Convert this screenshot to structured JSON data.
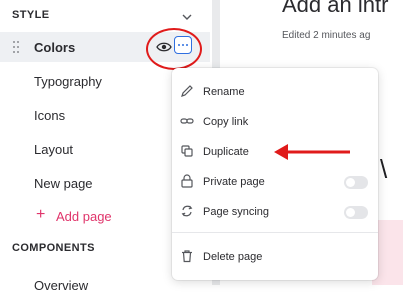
{
  "sidebar": {
    "style_header": "STYLE",
    "items": [
      {
        "label": "Colors"
      },
      {
        "label": "Typography"
      },
      {
        "label": "Icons"
      },
      {
        "label": "Layout"
      },
      {
        "label": "New page"
      }
    ],
    "add_page_label": "Add page",
    "add_page_plus": "+",
    "components_header": "COMPONENTS",
    "overview_label": "Overview"
  },
  "main": {
    "title": "Add an intr",
    "subtitle": "Edited 2 minutes ag",
    "ghost_letter": "\\"
  },
  "menu": {
    "rename": "Rename",
    "copy_link": "Copy link",
    "duplicate": "Duplicate",
    "private_page": "Private page",
    "page_syncing": "Page syncing",
    "delete_page": "Delete page",
    "private_page_enabled": false,
    "page_syncing_enabled": false
  },
  "colors": {
    "accent": "#2f6fe0",
    "annotation_red": "#e01b1b",
    "add_page_pink": "#e0356b"
  }
}
